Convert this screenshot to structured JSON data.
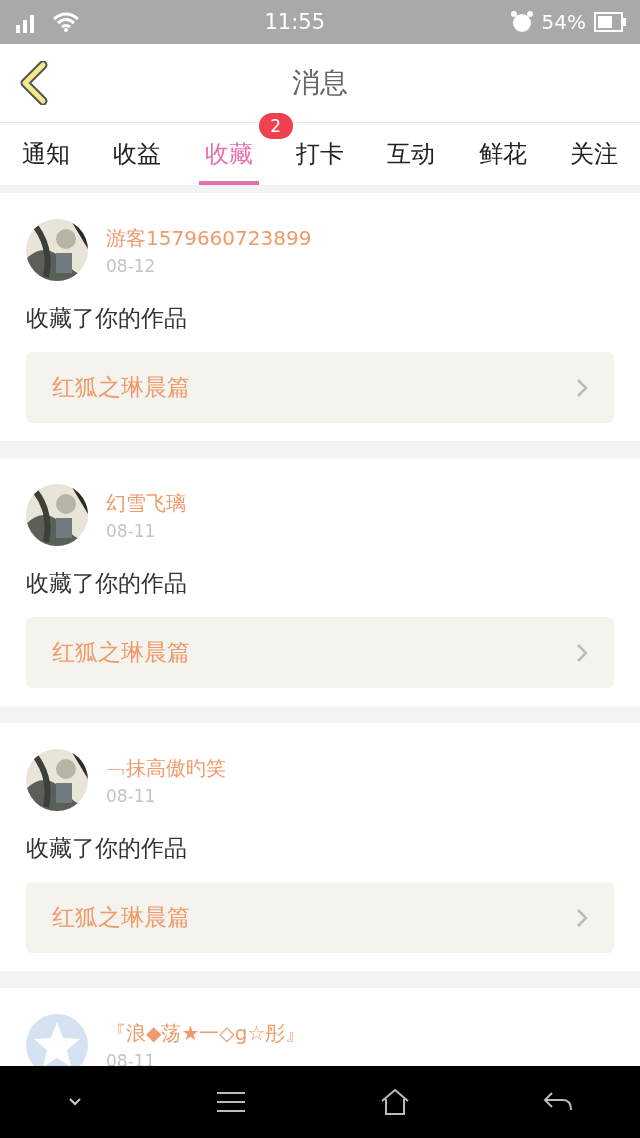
{
  "status_bar": {
    "time": "11:55",
    "battery": "54%"
  },
  "header": {
    "title": "消息"
  },
  "tabs": [
    {
      "label": "通知",
      "selected": false
    },
    {
      "label": "收益",
      "selected": false
    },
    {
      "label": "收藏",
      "selected": true,
      "badge": "2"
    },
    {
      "label": "打卡",
      "selected": false
    },
    {
      "label": "互动",
      "selected": false
    },
    {
      "label": "鲜花",
      "selected": false
    },
    {
      "label": "关注",
      "selected": false
    }
  ],
  "messages": [
    {
      "user": "游客1579660723899",
      "date": "08-12",
      "text": "收藏了你的作品",
      "work": "红狐之琳晨篇"
    },
    {
      "user": "幻雪飞璃",
      "date": "08-11",
      "text": "收藏了你的作品",
      "work": "红狐之琳晨篇"
    },
    {
      "user": "﹁抹高傲旳笑",
      "date": "08-11",
      "text": "收藏了你的作品",
      "work": "红狐之琳晨篇"
    },
    {
      "avatar": {
        "kind": "default"
      },
      "user": "『浪◆荡★一◇g☆彤』",
      "date": "08-11"
    }
  ]
}
